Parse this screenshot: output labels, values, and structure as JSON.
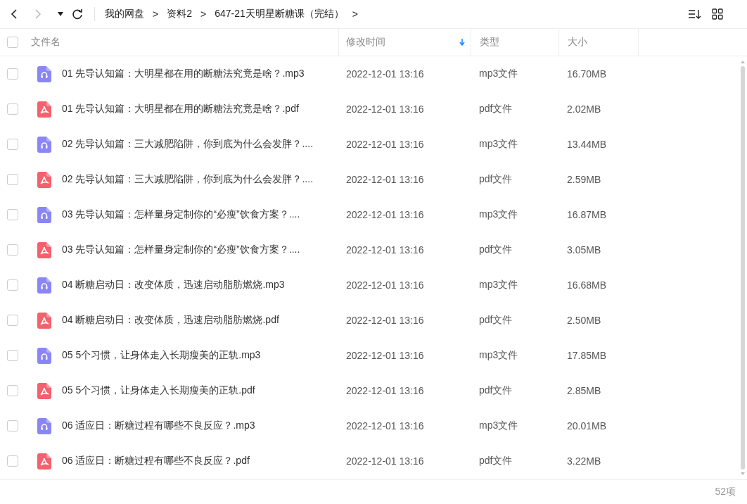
{
  "nav": {
    "back": {
      "disabled": false
    },
    "forward": {
      "disabled": true
    }
  },
  "breadcrumbs": [
    {
      "label": "我的网盘",
      "separator": ">"
    },
    {
      "label": "资料2",
      "separator": ">"
    },
    {
      "label": "647-21天明星断糖课（完结）",
      "separator": ">"
    }
  ],
  "table": {
    "select_all": {
      "checked": false
    },
    "columns": [
      {
        "label": "文件名",
        "sorted": false
      },
      {
        "label": "修改时间",
        "sorted": true
      },
      {
        "label": "类型",
        "sorted": false
      },
      {
        "label": "大小",
        "sorted": false
      }
    ],
    "rows": [
      {
        "kind": "mp3",
        "checked": false,
        "name": "01 先导认知篇：大明星都在用的断糖法究竟是啥？.mp3",
        "modified": "2022-12-01 13:16",
        "type": "mp3文件",
        "size": "16.70MB"
      },
      {
        "kind": "pdf",
        "checked": false,
        "name": "01 先导认知篇：大明星都在用的断糖法究竟是啥？.pdf",
        "modified": "2022-12-01 13:16",
        "type": "pdf文件",
        "size": "2.02MB"
      },
      {
        "kind": "mp3",
        "checked": false,
        "name": "02 先导认知篇：三大减肥陷阱，你到底为什么会发胖？....",
        "modified": "2022-12-01 13:16",
        "type": "mp3文件",
        "size": "13.44MB"
      },
      {
        "kind": "pdf",
        "checked": false,
        "name": "02 先导认知篇：三大减肥陷阱，你到底为什么会发胖？....",
        "modified": "2022-12-01 13:16",
        "type": "pdf文件",
        "size": "2.59MB"
      },
      {
        "kind": "mp3",
        "checked": false,
        "name": "03 先导认知篇：怎样量身定制你的“必瘦”饮食方案？....",
        "modified": "2022-12-01 13:16",
        "type": "mp3文件",
        "size": "16.87MB"
      },
      {
        "kind": "pdf",
        "checked": false,
        "name": "03 先导认知篇：怎样量身定制你的“必瘦”饮食方案？....",
        "modified": "2022-12-01 13:16",
        "type": "pdf文件",
        "size": "3.05MB"
      },
      {
        "kind": "mp3",
        "checked": false,
        "name": "04 断糖启动日：改变体质，迅速启动脂肪燃烧.mp3",
        "modified": "2022-12-01 13:16",
        "type": "mp3文件",
        "size": "16.68MB"
      },
      {
        "kind": "pdf",
        "checked": false,
        "name": "04 断糖启动日：改变体质，迅速启动脂肪燃烧.pdf",
        "modified": "2022-12-01 13:16",
        "type": "pdf文件",
        "size": "2.50MB"
      },
      {
        "kind": "mp3",
        "checked": false,
        "name": "05 5个习惯，让身体走入长期瘦美的正轨.mp3",
        "modified": "2022-12-01 13:16",
        "type": "mp3文件",
        "size": "17.85MB"
      },
      {
        "kind": "pdf",
        "checked": false,
        "name": "05 5个习惯，让身体走入长期瘦美的正轨.pdf",
        "modified": "2022-12-01 13:16",
        "type": "pdf文件",
        "size": "2.85MB"
      },
      {
        "kind": "mp3",
        "checked": false,
        "name": "06 适应日：断糖过程有哪些不良反应？.mp3",
        "modified": "2022-12-01 13:16",
        "type": "mp3文件",
        "size": "20.01MB"
      },
      {
        "kind": "pdf",
        "checked": false,
        "name": "06 适应日：断糖过程有哪些不良反应？.pdf",
        "modified": "2022-12-01 13:16",
        "type": "pdf文件",
        "size": "3.22MB"
      }
    ]
  },
  "status_bar": {
    "count": "52项"
  }
}
